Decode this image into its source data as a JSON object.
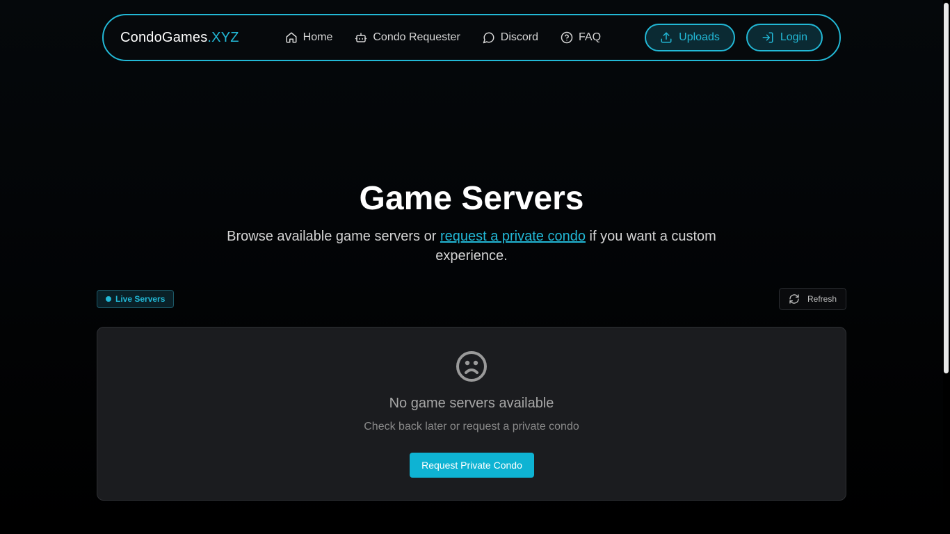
{
  "brand": {
    "name": "CondoGames",
    "tld": ".XYZ"
  },
  "nav": {
    "items": [
      {
        "label": "Home",
        "icon": "home-icon"
      },
      {
        "label": "Condo Requester",
        "icon": "bot-icon"
      },
      {
        "label": "Discord",
        "icon": "chat-bubble-icon"
      },
      {
        "label": "FAQ",
        "icon": "help-circle-icon"
      }
    ],
    "uploads_label": "Uploads",
    "login_label": "Login"
  },
  "hero": {
    "title": "Game Servers",
    "subtitle_before": "Browse available game servers or ",
    "subtitle_link": "request a private condo",
    "subtitle_after": " if you want a custom experience."
  },
  "toolbar": {
    "live_badge": "Live Servers",
    "refresh_label": "Refresh"
  },
  "empty_state": {
    "icon": "sad-face-icon",
    "title": "No game servers available",
    "subtitle": "Check back later or request a private condo",
    "button_label": "Request Private Condo"
  },
  "colors": {
    "accent": "#22b8d6",
    "primary_button": "#0eb3d3",
    "panel": "#1b1c1f"
  }
}
